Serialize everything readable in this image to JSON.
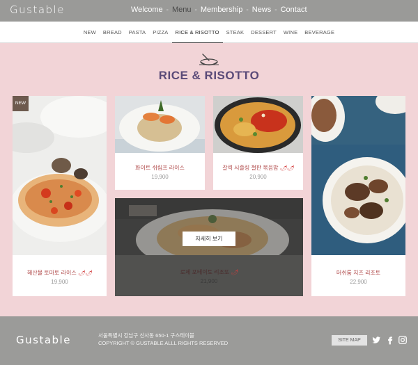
{
  "brand": {
    "logo": "Gustable"
  },
  "main_nav": [
    {
      "label": "Welcome",
      "active": false
    },
    {
      "label": "Menu",
      "active": true
    },
    {
      "label": "Membership",
      "active": false
    },
    {
      "label": "News",
      "active": false
    },
    {
      "label": "Contact",
      "active": false
    }
  ],
  "main_nav_separator": "-",
  "sub_nav": [
    {
      "label": "NEW",
      "active": false
    },
    {
      "label": "BREAD",
      "active": false
    },
    {
      "label": "PASTA",
      "active": false
    },
    {
      "label": "PIZZA",
      "active": false
    },
    {
      "label": "RICE & RISOTTO",
      "active": true
    },
    {
      "label": "STEAK",
      "active": false
    },
    {
      "label": "DESSERT",
      "active": false
    },
    {
      "label": "WINE",
      "active": false
    },
    {
      "label": "BEVERAGE",
      "active": false
    }
  ],
  "section": {
    "title": "RICE & RISOTTO",
    "icon": "dish-icon"
  },
  "products": [
    {
      "name": "해산물 토마토 라이스",
      "price": "19,900",
      "badge": "NEW",
      "spicy": "🌶🌶"
    },
    {
      "name": "화이트 쉬림프 라이스",
      "price": "19,900"
    },
    {
      "name": "갈릭 시즐링 철판 볶음밥",
      "price": "20,900",
      "spicy": "🌶🌶"
    },
    {
      "name": "머쉬룸 치즈 리조토",
      "price": "22,900"
    },
    {
      "name": "로제 포테이토 리조또",
      "price": "21,900",
      "spicy": "🌶",
      "button": "자세히 보기"
    }
  ],
  "footer": {
    "logo": "Gustable",
    "address": "서울특별시 강남구 신사동 650-1  구스테이블",
    "copyright": "COPYRIGHT © GUSTABLE ALLL RIGHTS RESERVED",
    "sitemap": "SITE MAP",
    "social": [
      "twitter-icon",
      "facebook-icon",
      "instagram-icon"
    ]
  },
  "colors": {
    "header_bg": "#9a9a98",
    "page_bg": "#f2d4d7",
    "title": "#5a4a78",
    "product_name": "#b04a4a",
    "badge_bg": "#6d5a4e",
    "footer_bg": "#9b9b99"
  }
}
